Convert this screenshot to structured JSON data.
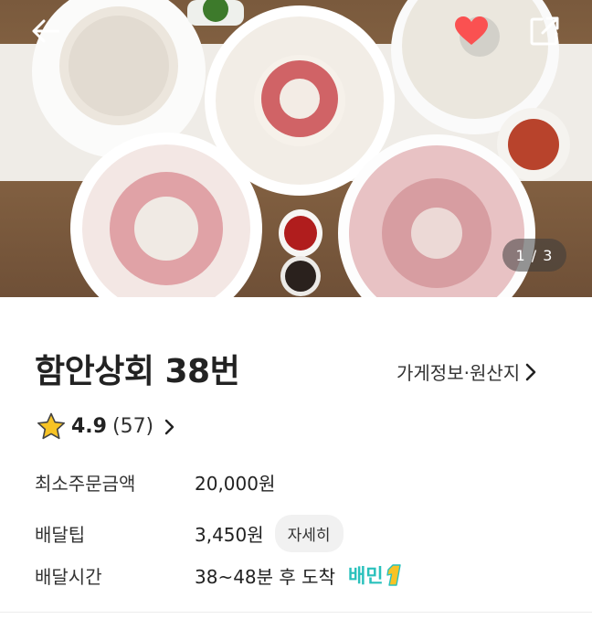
{
  "header": {
    "back_icon": "back-arrow-icon",
    "favorite_icon": "heart-icon",
    "share_icon": "share-icon",
    "favorite_color": "#fa5151",
    "pager": "1 / 3"
  },
  "store": {
    "name": "함안상회 38번",
    "info_link": "가게정보·원산지",
    "rating_score": "4.9",
    "rating_count": "(57)"
  },
  "details": {
    "min_order_label": "최소주문금액",
    "min_order_value": "20,000원",
    "delivery_tip_label": "배달팁",
    "delivery_tip_value": "3,450원",
    "detail_button": "자세히",
    "delivery_time_label": "배달시간",
    "delivery_time_value": "38~48분 후 도착",
    "badge_text": "배민",
    "badge_number": "1"
  },
  "colors": {
    "accent": "#2ac1bc",
    "star": "#f7c325",
    "heart": "#fa5151"
  }
}
